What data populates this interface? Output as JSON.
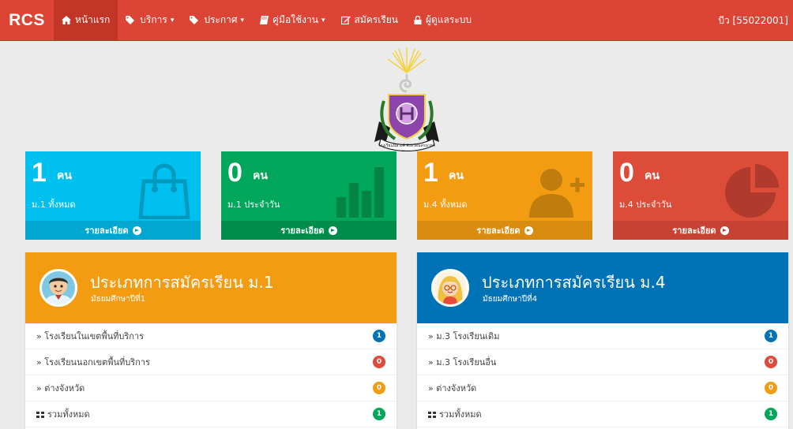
{
  "navbar": {
    "brand": "RCS",
    "items": [
      {
        "label": "หน้าแรก",
        "icon": "home-icon",
        "active": true,
        "caret": false
      },
      {
        "label": "บริการ",
        "icon": "tag-icon",
        "active": false,
        "caret": true
      },
      {
        "label": "ประกาศ",
        "icon": "tag-icon",
        "active": false,
        "caret": true
      },
      {
        "label": "คู่มือใช้งาน",
        "icon": "book-icon",
        "active": false,
        "caret": true
      },
      {
        "label": "สมัครเรียน",
        "icon": "edit-icon",
        "active": false,
        "caret": false
      },
      {
        "label": "ผู้ดูแลระบบ",
        "icon": "lock-icon",
        "active": false,
        "caret": false
      }
    ],
    "user": "บีว [55022001]"
  },
  "logo": {
    "alt": "school-emblem",
    "caption": "โรงเรียนนิลวงศ์ จังหวัดนครนายก"
  },
  "tiles": [
    {
      "value": "1",
      "unit": "คน",
      "label": "ม.1 ทั้งหมด",
      "footer": "รายละเอียด",
      "icon": "shopping-bag-icon",
      "color": "#00c0ef"
    },
    {
      "value": "0",
      "unit": "คน",
      "label": "ม.1 ประจำวัน",
      "footer": "รายละเอียด",
      "icon": "bar-chart-icon",
      "color": "#00a65a"
    },
    {
      "value": "1",
      "unit": "คน",
      "label": "ม.4 ทั้งหมด",
      "footer": "รายละเอียด",
      "icon": "user-add-icon",
      "color": "#f39c12"
    },
    {
      "value": "0",
      "unit": "คน",
      "label": "ม.4 ประจำวัน",
      "footer": "รายละเอียด",
      "icon": "pie-chart-icon",
      "color": "#dd4b39"
    }
  ],
  "panels": [
    {
      "title": "ประเภทการสมัครเรียน ม.1",
      "subtitle": "มัธยมศึกษาปีที่1",
      "color": "#f39c12",
      "rows": [
        {
          "label": "» โรงเรียนในเขตพื้นที่บริการ",
          "count": "1",
          "badge": "blue"
        },
        {
          "label": "» โรงเรียนนอกเขตพื้นที่บริการ",
          "count": "0",
          "badge": "red"
        },
        {
          "label": "» ต่างจังหวัด",
          "count": "0",
          "badge": "yellow"
        },
        {
          "label": "รวมทั้งหมด",
          "count": "1",
          "badge": "green"
        }
      ]
    },
    {
      "title": "ประเภทการสมัครเรียน ม.4",
      "subtitle": "มัธยมศึกษาปีที่4",
      "color": "#0073b7",
      "rows": [
        {
          "label": "» ม.3 โรงเรียนเดิม",
          "count": "1",
          "badge": "blue"
        },
        {
          "label": "» ม.3 โรงเรียนอื่น",
          "count": "0",
          "badge": "red"
        },
        {
          "label": "» ต่างจังหวัด",
          "count": "0",
          "badge": "yellow"
        },
        {
          "label": "รวมทั้งหมด",
          "count": "1",
          "badge": "green"
        }
      ]
    }
  ]
}
